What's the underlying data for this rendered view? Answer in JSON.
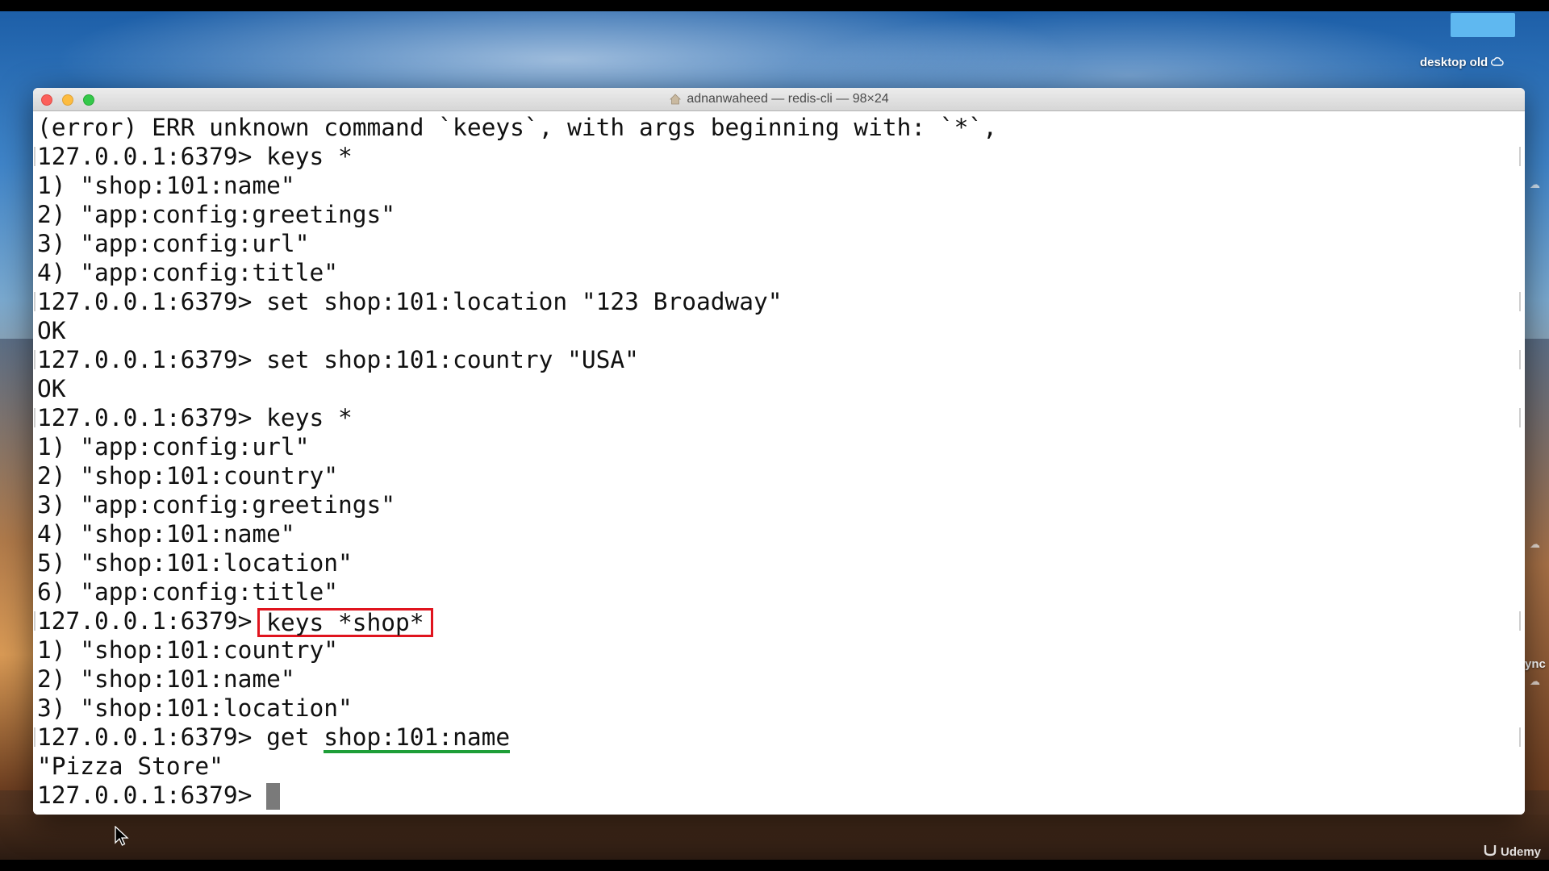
{
  "desktop": {
    "folder_label": "desktop old",
    "edge_label": "ync",
    "watermark": "Udemy"
  },
  "window": {
    "title": "adnanwaheed — redis-cli — 98×24"
  },
  "terminal": {
    "prompt": "127.0.0.1:6379> ",
    "lines": [
      "(error) ERR unknown command `keeys`, with args beginning with: `*`,",
      "127.0.0.1:6379> keys *",
      "1) \"shop:101:name\"",
      "2) \"app:config:greetings\"",
      "3) \"app:config:url\"",
      "4) \"app:config:title\"",
      "127.0.0.1:6379> set shop:101:location \"123 Broadway\"",
      "OK",
      "127.0.0.1:6379> set shop:101:country \"USA\"",
      "OK",
      "127.0.0.1:6379> keys *",
      "1) \"app:config:url\"",
      "2) \"shop:101:country\"",
      "3) \"app:config:greetings\"",
      "4) \"shop:101:name\"",
      "5) \"shop:101:location\"",
      "6) \"app:config:title\""
    ],
    "highlighted_command": "keys *shop*",
    "lines_after": [
      "1) \"shop:101:country\"",
      "2) \"shop:101:name\"",
      "3) \"shop:101:location\""
    ],
    "get_command": "get ",
    "get_key": "shop:101:name",
    "result": "\"Pizza Store\""
  }
}
